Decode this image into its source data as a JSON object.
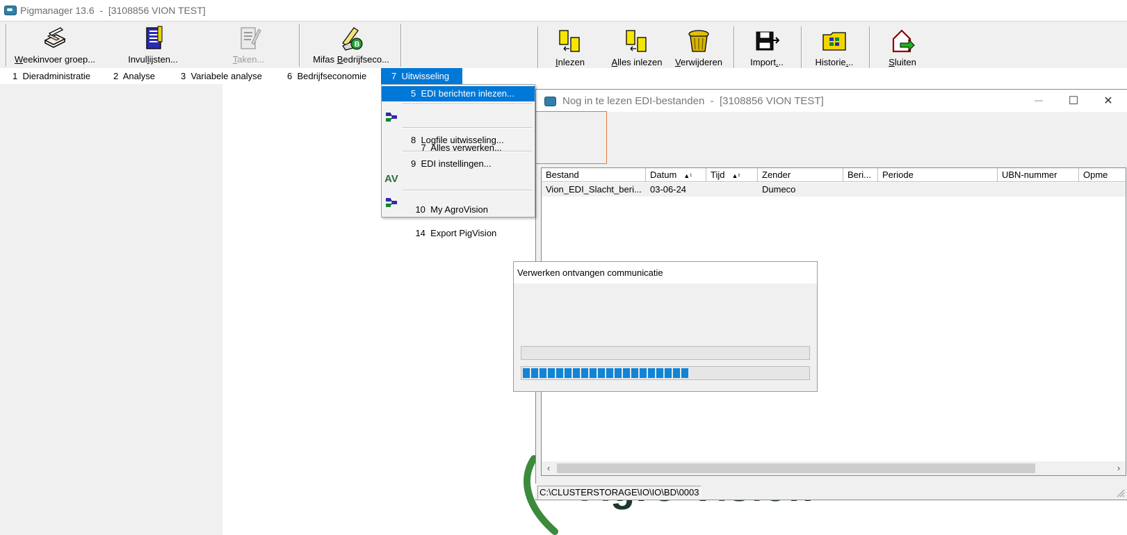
{
  "main_window": {
    "title": "Pigmanager 13.6  -  [3108856 VION TEST]"
  },
  "toolbar": {
    "buttons": [
      {
        "label_pre": "",
        "label_u": "W",
        "label_post": "eekinvoer groep...",
        "icon": "pencil-book-icon",
        "enabled": true
      },
      {
        "label_pre": "Invul",
        "label_u": "l",
        "label_post": "ijsten...",
        "icon": "clipboard-icon",
        "enabled": true
      },
      {
        "label_pre": "",
        "label_u": "T",
        "label_post": "aken...",
        "icon": "task-pen-icon",
        "enabled": false
      },
      {
        "label_pre": "Mifas ",
        "label_u": "B",
        "label_post": "edrijfseco...",
        "icon": "mifas-b-icon",
        "enabled": true
      }
    ]
  },
  "menubar": {
    "items": [
      {
        "label": "1  Dieradministratie"
      },
      {
        "label": "2  Analyse"
      },
      {
        "label": "3  Variabele analyse"
      },
      {
        "label": "6  Bedrijfseconomie"
      },
      {
        "label": "7  Uitwisseling"
      }
    ]
  },
  "dropdown": {
    "items": [
      {
        "label": "5  EDI berichten inlezen...",
        "icon": ""
      },
      {
        "label": "7  Alles verwerken...",
        "icon": "process-all-icon"
      },
      {
        "label": "8  Logfile uitwisseling...",
        "icon": ""
      },
      {
        "label": "9  EDI instellingen...",
        "icon": ""
      },
      {
        "label": "10  My AgroVision",
        "icon": "agrovision-icon",
        "icon_text": "AV"
      },
      {
        "label": "14  Export PigVision",
        "icon": "export-icon"
      }
    ]
  },
  "edi_window": {
    "title": "Nog in te lezen EDI-bestanden  -  [3108856 VION TEST]",
    "toolbar": [
      {
        "label_pre": "",
        "label_u": "I",
        "label_post": "nlezen",
        "icon": "read-files-icon"
      },
      {
        "label_pre": "",
        "label_u": "A",
        "label_post": "lles inlezen",
        "icon": "read-all-icon"
      },
      {
        "label_pre": "",
        "label_u": "V",
        "label_post": "erwijderen",
        "icon": "trash-can-icon"
      },
      {
        "label_pre": "Import",
        "label_u": ".",
        "label_post": "..",
        "icon": "import-icon"
      },
      {
        "label_pre": "Historie",
        "label_u": ".",
        "label_post": "..",
        "icon": "history-folder-icon"
      },
      {
        "label_pre": "",
        "label_u": "S",
        "label_post": "luiten",
        "icon": "exit-house-icon"
      }
    ],
    "columns": [
      "Bestand",
      "Datum",
      "Tijd",
      "Zender",
      "Beri...",
      "Periode",
      "UBN-nummer",
      "Opme"
    ],
    "sort_markers": {
      "datum": "▲¹",
      "tijd": "▲²"
    },
    "rows": [
      {
        "bestand": "Vion_EDI_Slacht_beri...",
        "datum": "03-06-24",
        "tijd": "",
        "zender": "Dumeco",
        "beri": "",
        "periode": "",
        "ubn": "",
        "opme": ""
      }
    ],
    "status_path": "C:\\CLUSTERSTORAGE\\IO\\IO\\BD\\0003"
  },
  "progress_dialog": {
    "title": "Verwerken ontvangen communicatie",
    "bar1_fraction": 0,
    "bar2_fraction": 0.6
  },
  "background_logo": {
    "text": "Agro Vision"
  },
  "colors": {
    "accent": "#0078d7",
    "progress": "#0f84d8",
    "focus_border": "#e07a3a"
  }
}
